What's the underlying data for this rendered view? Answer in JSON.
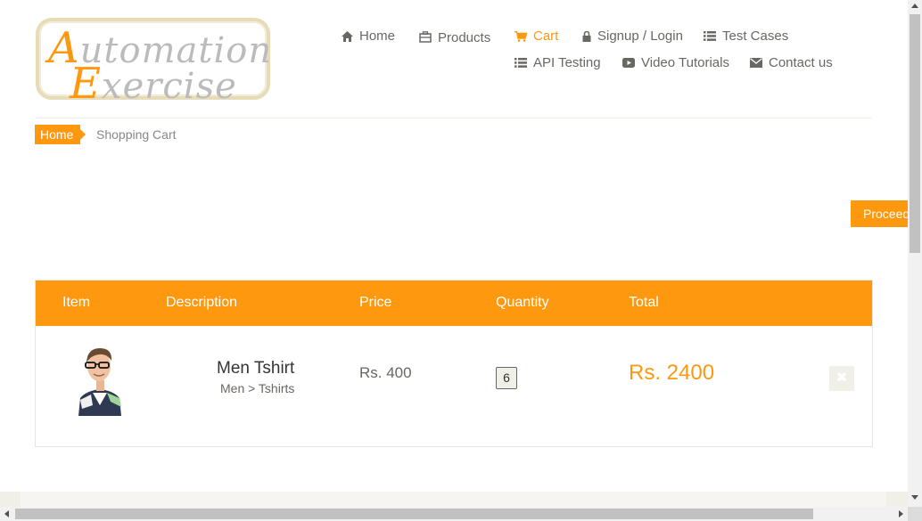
{
  "logo": {
    "line1_cap": "A",
    "line1_rest": "utomation",
    "line2_cap": "E",
    "line2_rest": "xercise"
  },
  "nav": {
    "items": [
      {
        "label": "Home",
        "icon": "home-icon"
      },
      {
        "label": "Products",
        "icon": "products-icon"
      },
      {
        "label": "Cart",
        "icon": "cart-icon",
        "active": true
      },
      {
        "label": "Signup / Login",
        "icon": "lock-icon"
      },
      {
        "label": "Test Cases",
        "icon": "list-icon"
      },
      {
        "label": "API Testing",
        "icon": "list-icon"
      },
      {
        "label": "Video Tutorials",
        "icon": "youtube-play-icon"
      },
      {
        "label": "Contact us",
        "icon": "envelope-icon"
      }
    ]
  },
  "breadcrumb": {
    "home": "Home",
    "current": "Shopping Cart"
  },
  "proceed_button": "Proceed To Checkout",
  "cart": {
    "headers": {
      "item": "Item",
      "description": "Description",
      "price": "Price",
      "quantity": "Quantity",
      "total": "Total"
    },
    "rows": [
      {
        "name": "Men Tshirt",
        "category": "Men > Tshirts",
        "price": "Rs. 400",
        "quantity": "6",
        "total": "Rs. 2400",
        "delete_icon": "close-icon"
      }
    ]
  },
  "colors": {
    "accent": "#fe980f",
    "text": "#696763",
    "header_text": "#ffffff"
  }
}
